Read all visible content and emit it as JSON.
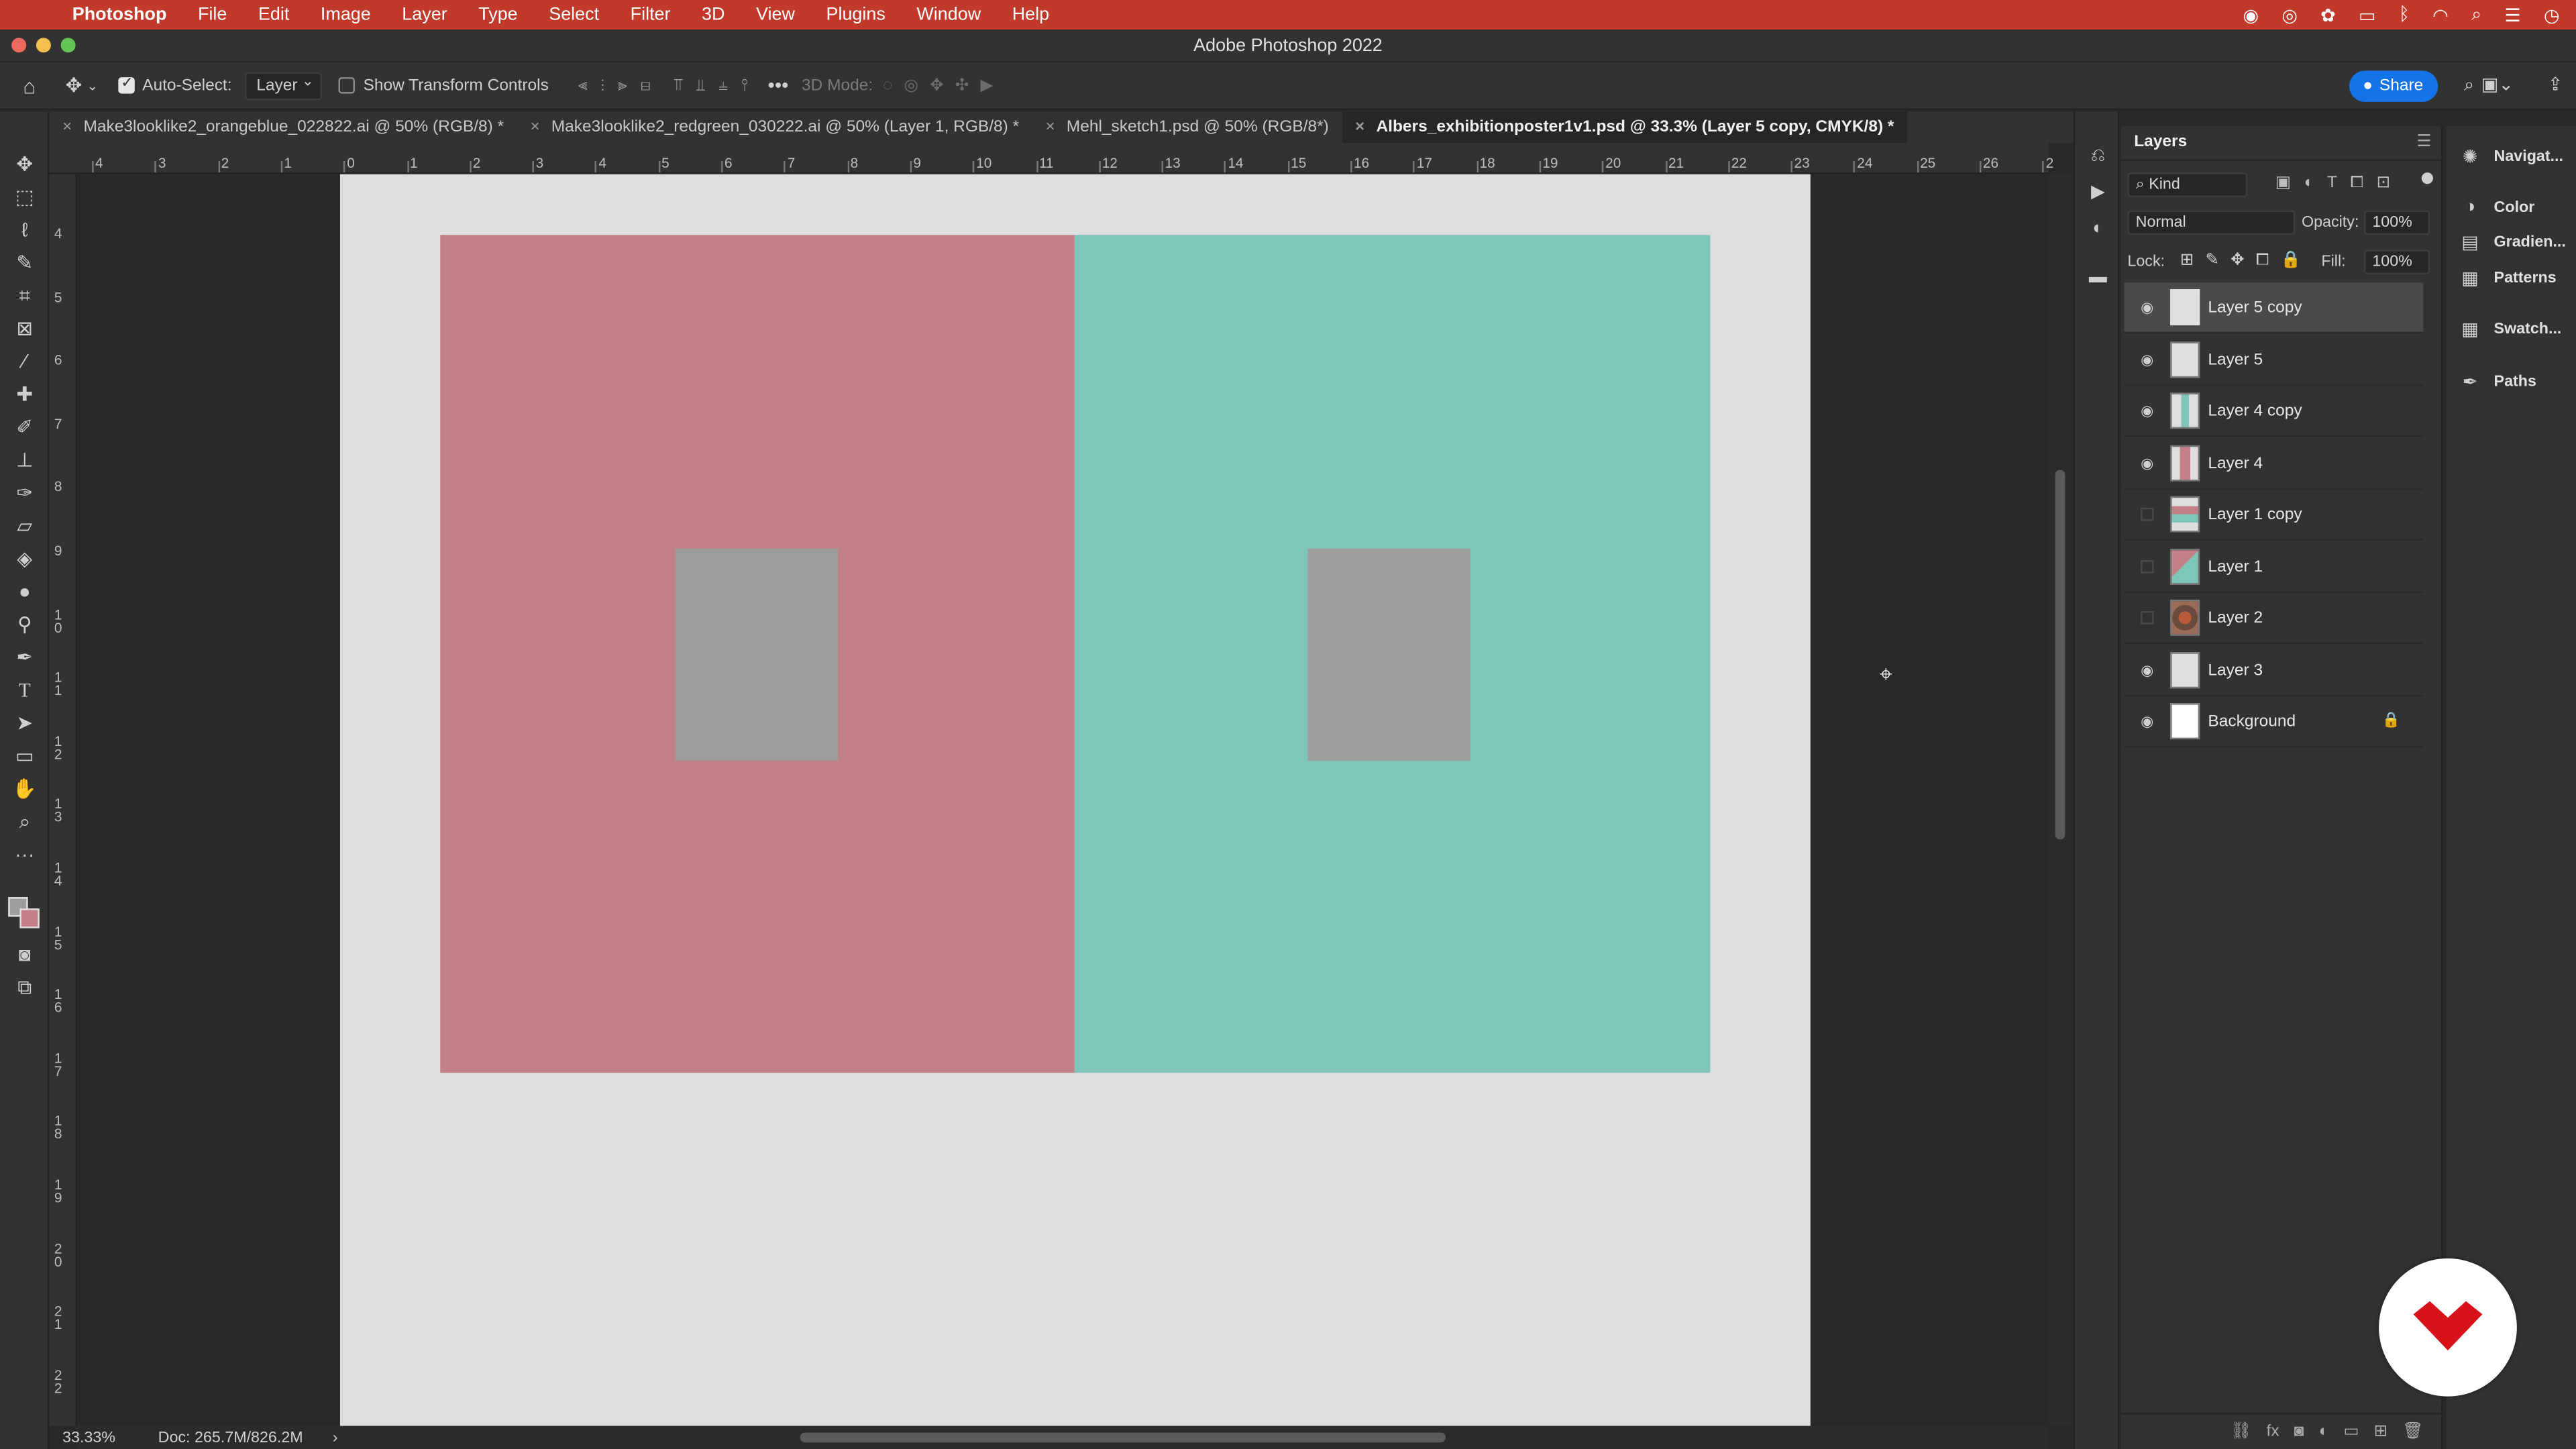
{
  "menubar": {
    "app": "Photoshop",
    "items": [
      "File",
      "Edit",
      "Image",
      "Layer",
      "Type",
      "Select",
      "Filter",
      "3D",
      "View",
      "Plugins",
      "Window",
      "Help"
    ]
  },
  "window": {
    "title": "Adobe Photoshop 2022"
  },
  "options": {
    "auto_select_label": "Auto-Select:",
    "auto_select_value": "Layer",
    "show_transform_label": "Show Transform Controls",
    "mode_3d_label": "3D Mode:",
    "share_label": "Share"
  },
  "tabs": [
    {
      "label": "Make3looklike2_orangeblue_022822.ai @ 50% (RGB/8) *",
      "active": false
    },
    {
      "label": "Make3looklike2_redgreen_030222.ai @ 50% (Layer 1, RGB/8) *",
      "active": false
    },
    {
      "label": "Mehl_sketch1.psd @ 50% (RGB/8*)",
      "active": false
    },
    {
      "label": "Albers_exhibitionposter1v1.psd @ 33.3% (Layer 5 copy, CMYK/8) *",
      "active": true
    }
  ],
  "ruler": {
    "h_labels": [
      "4",
      "3",
      "2",
      "1",
      "0",
      "1",
      "2",
      "3",
      "4",
      "5",
      "6",
      "7",
      "8",
      "9",
      "10",
      "11",
      "12",
      "13",
      "14",
      "15",
      "16",
      "17",
      "18",
      "19",
      "20",
      "21",
      "22",
      "23",
      "24",
      "25",
      "26",
      "2"
    ],
    "v_labels": [
      "4",
      "5",
      "6",
      "7",
      "8",
      "9",
      "1 0",
      "1 1",
      "1 2",
      "1 3",
      "1 4",
      "1 5",
      "1 6",
      "1 7",
      "1 8",
      "1 9",
      "2 0",
      "2 1",
      "2 2"
    ]
  },
  "artwork": {
    "left_color": "#c48087",
    "right_color": "#80c5ba",
    "inner_color": "#9d9e9b",
    "paper_color": "#dedede"
  },
  "status": {
    "zoom": "33.33%",
    "doc": "Doc: 265.7M/826.2M"
  },
  "layers_panel": {
    "title": "Layers",
    "filter_kind": "Kind",
    "blend_mode": "Normal",
    "opacity_label": "Opacity:",
    "opacity_value": "100%",
    "lock_label": "Lock:",
    "fill_label": "Fill:",
    "fill_value": "100%",
    "layers": [
      {
        "name": "Layer 5 copy",
        "visible": true,
        "selected": true
      },
      {
        "name": "Layer 5",
        "visible": true,
        "selected": false
      },
      {
        "name": "Layer 4 copy",
        "visible": true,
        "selected": false
      },
      {
        "name": "Layer 4",
        "visible": true,
        "selected": false
      },
      {
        "name": "Layer 1 copy",
        "visible": false,
        "selected": false
      },
      {
        "name": "Layer 1",
        "visible": false,
        "selected": false
      },
      {
        "name": "Layer 2",
        "visible": false,
        "selected": false
      },
      {
        "name": "Layer 3",
        "visible": true,
        "selected": false
      },
      {
        "name": "Background",
        "visible": true,
        "selected": false,
        "locked": true
      }
    ]
  },
  "dock": {
    "items": [
      "Navigat...",
      "Color",
      "Gradien...",
      "Patterns",
      "Swatch...",
      "Paths"
    ]
  }
}
